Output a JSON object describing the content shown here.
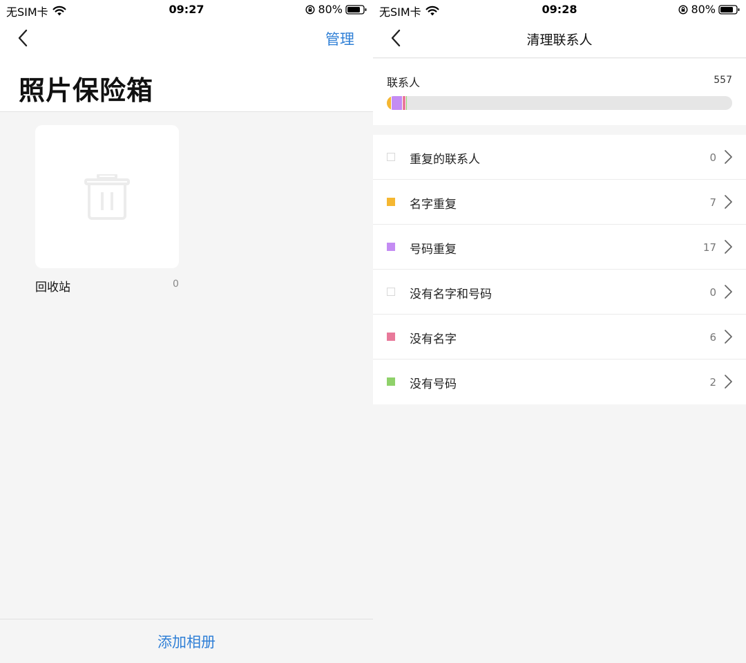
{
  "colors": {
    "accent": "#2f7fd6",
    "duplicate_name": "#f5b731",
    "duplicate_number": "#c48cf3",
    "no_name": "#e8799a",
    "no_number": "#8fd16a"
  },
  "left": {
    "statusbar": {
      "carrier": "无SIM卡",
      "time": "09:27",
      "battery": "80%"
    },
    "header": {
      "manage_label": "管理",
      "title": "照片保险箱"
    },
    "album": {
      "name": "回收站",
      "count": "0",
      "icon": "trash-icon"
    },
    "footer": {
      "add_album_label": "添加相册"
    }
  },
  "right": {
    "statusbar": {
      "carrier": "无SIM卡",
      "time": "09:28",
      "battery": "80%"
    },
    "nav": {
      "title": "清理联系人"
    },
    "summary": {
      "label": "联系人",
      "total": "557",
      "bar_segments": [
        {
          "name": "名字重复",
          "value": 7,
          "color": "#f5b731"
        },
        {
          "name": "号码重复",
          "value": 17,
          "color": "#c48cf3"
        },
        {
          "name": "没有名字",
          "value": 6,
          "color": "#e8799a"
        },
        {
          "name": "没有号码",
          "value": 2,
          "color": "#8fd16a"
        }
      ]
    },
    "items": [
      {
        "label": "重复的联系人",
        "count": "0",
        "color": ""
      },
      {
        "label": "名字重复",
        "count": "7",
        "color": "#f5b731"
      },
      {
        "label": "号码重复",
        "count": "17",
        "color": "#c48cf3"
      },
      {
        "label": "没有名字和号码",
        "count": "0",
        "color": ""
      },
      {
        "label": "没有名字",
        "count": "6",
        "color": "#e8799a"
      },
      {
        "label": "没有号码",
        "count": "2",
        "color": "#8fd16a"
      }
    ]
  }
}
